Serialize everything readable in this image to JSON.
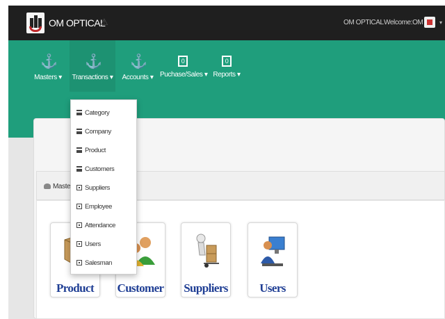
{
  "header": {
    "brand": "OM OPTICAL",
    "warning_glyph": "⚠",
    "company_right": "OM OPTICAL",
    "welcome": "Welcome:OM",
    "caret": "▾"
  },
  "nav": {
    "items": [
      {
        "label": "Masters ▾",
        "icon": "anchor-icon"
      },
      {
        "label": "Transactions ▾",
        "icon": "anchor-icon"
      },
      {
        "label": "Accounts ▾",
        "icon": "anchor-icon"
      },
      {
        "label": "Puchase/Sales ▾",
        "icon": "box-icon"
      },
      {
        "label": "Reports ▾",
        "icon": "box-icon"
      }
    ],
    "anchor_glyph": "⚓",
    "box_glyph": "0"
  },
  "panel": {
    "breadcrumb": "Master"
  },
  "tiles": [
    {
      "label": "Product"
    },
    {
      "label": "Customer"
    },
    {
      "label": "Suppliers"
    },
    {
      "label": "Users"
    }
  ],
  "dropdown": {
    "items": [
      {
        "label": "Category",
        "icon": "list"
      },
      {
        "label": "Company",
        "icon": "list"
      },
      {
        "label": "Product",
        "icon": "list"
      },
      {
        "label": "Customers",
        "icon": "list"
      },
      {
        "label": "Suppliers",
        "icon": "box"
      },
      {
        "label": "Employee",
        "icon": "box"
      },
      {
        "label": "Attendance",
        "icon": "box"
      },
      {
        "label": "Users",
        "icon": "box"
      },
      {
        "label": "Salesman",
        "icon": "box"
      }
    ]
  },
  "colors": {
    "topbar": "#1f1f1f",
    "nav": "#1f9e7c",
    "tile_label": "#1f3e94"
  }
}
